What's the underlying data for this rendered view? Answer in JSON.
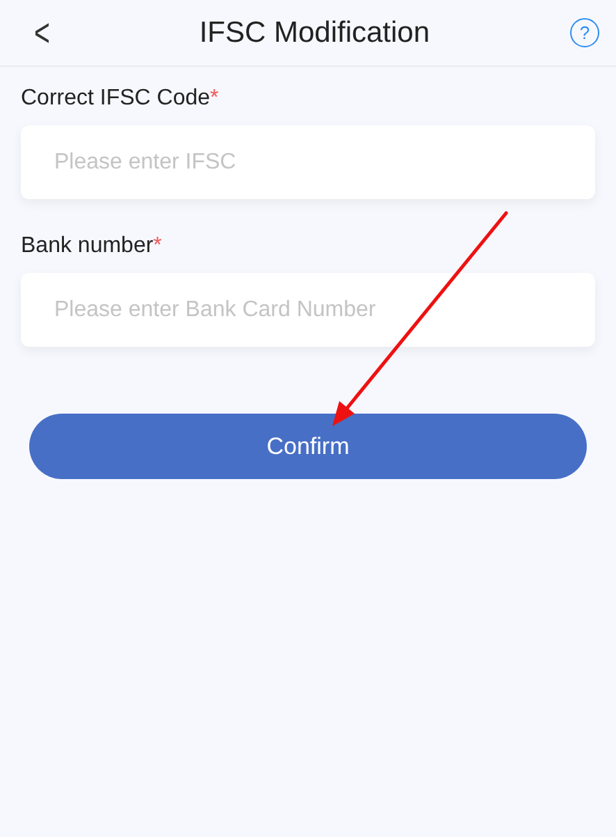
{
  "header": {
    "back": "<",
    "title": "IFSC Modification",
    "help": "?"
  },
  "fields": [
    {
      "label": "Correct IFSC Code",
      "required_mark": "*",
      "placeholder": "Please enter IFSC"
    },
    {
      "label": "Bank number",
      "required_mark": "*",
      "placeholder": "Please enter Bank Card Number"
    }
  ],
  "confirm_button": "Confirm"
}
